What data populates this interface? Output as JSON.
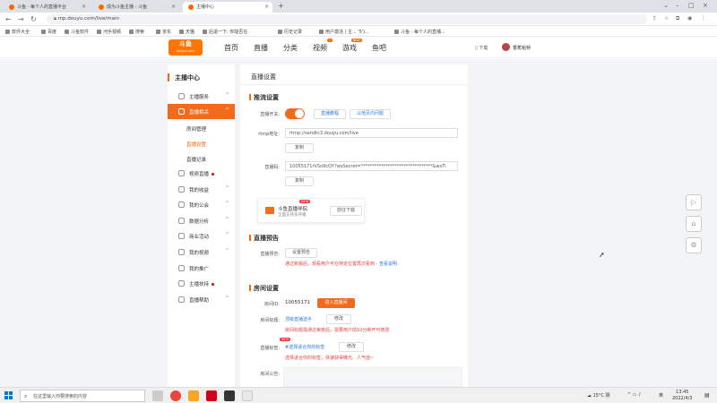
{
  "browser": {
    "tabs": [
      {
        "label": "斗鱼 - 每个人的直播平台",
        "active": false
      },
      {
        "label": "成为斗鱼主播 - 斗鱼",
        "active": false
      },
      {
        "label": "主播中心",
        "active": true
      }
    ],
    "new_tab": "+",
    "url": "mp.douyu.com/live/main",
    "bookmarks": [
      "软件大全",
      "百度",
      "斗鱼软件",
      "河手视频",
      "搜索",
      "京东",
      "天猫",
      "后退一下: 你能否在",
      "历史记录",
      "用户激活 | 主... '5')...",
      "斗鱼 - 每个人的直播..."
    ]
  },
  "site": {
    "logo": {
      "text": "斗鱼",
      "sub": "douyu.com"
    },
    "nav": [
      {
        "label": "首页",
        "badge": ""
      },
      {
        "label": "直播",
        "badge": ""
      },
      {
        "label": "分类",
        "badge": ""
      },
      {
        "label": "视频",
        "badge": "•"
      },
      {
        "label": "游戏",
        "badge": "NEW"
      },
      {
        "label": "鱼吧",
        "badge": ""
      }
    ],
    "download": "下载",
    "user": "香蕉帕特"
  },
  "sidebar": {
    "title": "主播中心",
    "items": [
      {
        "label": "主播服务",
        "chevron": "^",
        "dot": false
      },
      {
        "label": "直播相关",
        "chevron": "^",
        "dot": false,
        "active": true
      },
      {
        "label": "视频直播",
        "chevron": "",
        "dot": true
      },
      {
        "label": "我的收益",
        "chevron": "^",
        "dot": false
      },
      {
        "label": "我的公会",
        "chevron": "^",
        "dot": false
      },
      {
        "label": "数据分析",
        "chevron": "^",
        "dot": false
      },
      {
        "label": "商业活动",
        "chevron": "^",
        "dot": false
      },
      {
        "label": "我的视频",
        "chevron": "^",
        "dot": false
      },
      {
        "label": "我的推广",
        "chevron": "",
        "dot": false
      },
      {
        "label": "主播扶持",
        "chevron": "",
        "dot": true
      },
      {
        "label": "直播帮助",
        "chevron": "^",
        "dot": false
      }
    ],
    "subitems": [
      {
        "label": "房间管理",
        "active": false
      },
      {
        "label": "直播设置",
        "active": true
      },
      {
        "label": "直播记录",
        "active": false
      }
    ]
  },
  "main": {
    "title": "直播设置",
    "push": {
      "heading": "推流设置",
      "switch_label": "直播开关:",
      "tab1": "直播教程",
      "tab2": "以他页内问题",
      "rtmp_label": "rtmp地址:",
      "rtmp_value": "rtmp://sendtc3.douyu.com/live",
      "copy1": "复制",
      "code_label": "直播码:",
      "code_value": "10055171rVSo9cQY?wsSecret=********************************&wsTi",
      "copy2": "复制"
    },
    "promo": {
      "badge": "NEW",
      "title": "斗鱼直播伴侣",
      "desc": "全面支持多开播",
      "button": "前往下载"
    },
    "preview": {
      "heading": "直播预告",
      "label": "直播预告:",
      "button": "设置预告",
      "note": "通过新版后，观看用户可在特定位置再次看到 - ",
      "note_link": "查看说明"
    },
    "room": {
      "heading": "房间设置",
      "id_label": "房间ID:",
      "id_value": "10055171",
      "enter_button": "进入直播间",
      "title_label": "房间标题:",
      "title_value": "顶级直播选手",
      "title_edit": "修改",
      "title_note": "房间标题需通过审核后，需要用户前10分钟开可修改",
      "tag_label": "直播标签:",
      "tag_badge": "NEW",
      "tag_value": "#选择适合你的标签",
      "tag_edit": "修改",
      "tag_note": "选择适合你的标签，快速获得曝光、人气值~",
      "notice_label": "房间公告:"
    }
  },
  "taskbar": {
    "search_placeholder": "在这里输入你要搜索的内容",
    "weather": "15°C 阴",
    "ime": "英",
    "time": "13:45",
    "date": "2022/4/3"
  },
  "colors": {
    "accent": "#f26a1b",
    "link": "#2a7ae2",
    "warn": "#e53e3e"
  }
}
